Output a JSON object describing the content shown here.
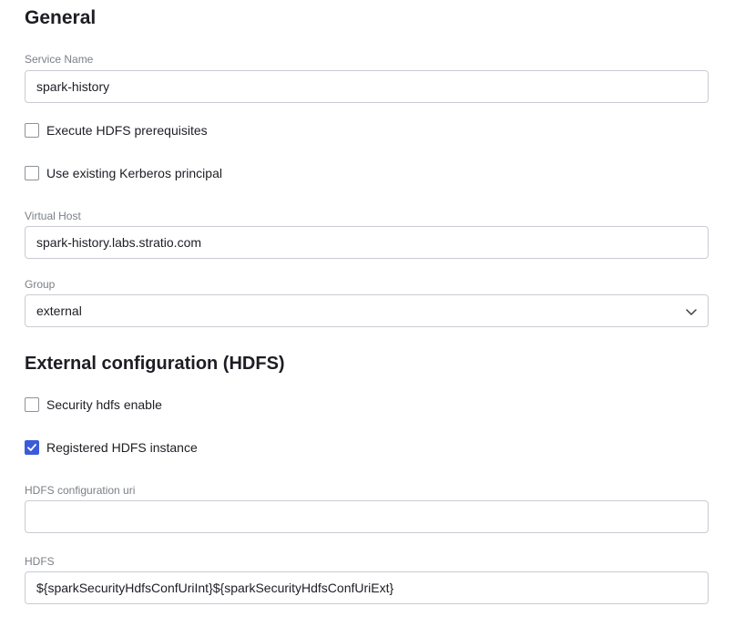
{
  "general": {
    "title": "General",
    "service_name": {
      "label": "Service Name",
      "value": "spark-history"
    },
    "execute_hdfs": {
      "label": "Execute HDFS prerequisites",
      "checked": false
    },
    "use_kerberos": {
      "label": "Use existing Kerberos principal",
      "checked": false
    },
    "virtual_host": {
      "label": "Virtual Host",
      "value": "spark-history.labs.stratio.com"
    },
    "group": {
      "label": "Group",
      "selected": "external"
    }
  },
  "external_hdfs": {
    "title": "External configuration (HDFS)",
    "security_hdfs": {
      "label": "Security hdfs enable",
      "checked": false
    },
    "registered_hdfs": {
      "label": "Registered HDFS instance",
      "checked": true
    },
    "hdfs_config_uri": {
      "label": "HDFS configuration uri",
      "value": ""
    },
    "hdfs": {
      "label": "HDFS",
      "value": "${sparkSecurityHdfsConfUriInt}${sparkSecurityHdfsConfUriExt}"
    }
  },
  "colors": {
    "accent": "#3b5bdb",
    "border": "#c8ccd2",
    "label": "#7a7f87"
  },
  "icons": {
    "select": "chevron-down-icon",
    "check": "check-icon"
  }
}
